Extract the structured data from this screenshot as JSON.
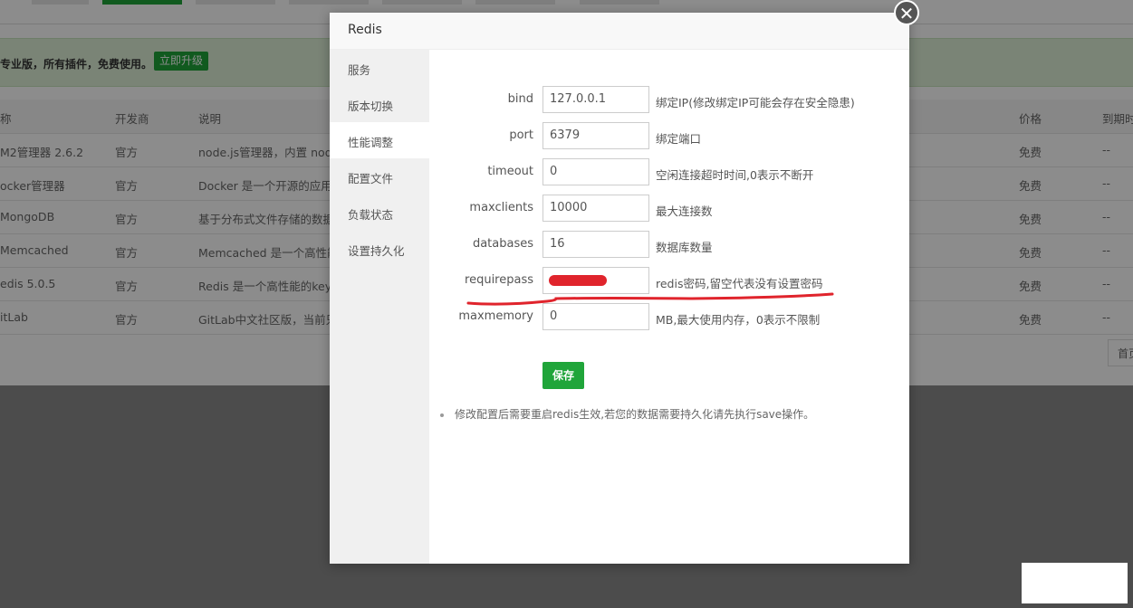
{
  "background": {
    "banner_text": "专业版，所有插件，免费使用。",
    "upgrade_label": "立即升级",
    "columns": {
      "name": "称",
      "developer": "开发商",
      "description": "说明",
      "price": "价格",
      "expire": "到期时"
    },
    "rows": [
      {
        "name": "M2管理器 2.6.2",
        "developer": "官方",
        "description": "node.js管理器，内置 node",
        "price": "免费",
        "expire": "--"
      },
      {
        "name": "ocker管理器",
        "developer": "官方",
        "description": "Docker 是一个开源的应用容",
        "price": "免费",
        "expire": "--"
      },
      {
        "name": "MongoDB",
        "developer": "官方",
        "description": "基于分布式文件存储的数据",
        "price": "免费",
        "expire": "--"
      },
      {
        "name": "Memcached",
        "developer": "官方",
        "description": "Memcached 是一个高性能",
        "price": "免费",
        "expire": "--"
      },
      {
        "name": "edis 5.0.5",
        "developer": "官方",
        "description": "Redis 是一个高性能的key-v",
        "price": "免费",
        "expire": "--"
      },
      {
        "name": "itLab",
        "developer": "官方",
        "description": "GitLab中文社区版，当前只",
        "price": "免费",
        "expire": "--"
      }
    ],
    "pager_label": "首页"
  },
  "modal": {
    "title": "Redis",
    "close_glyph": "✕",
    "sidebar": [
      {
        "label": "服务"
      },
      {
        "label": "版本切换"
      },
      {
        "label": "性能调整",
        "active": true
      },
      {
        "label": "配置文件"
      },
      {
        "label": "负载状态"
      },
      {
        "label": "设置持久化"
      }
    ],
    "fields": [
      {
        "label": "bind",
        "value": "127.0.0.1",
        "desc": "绑定IP(修改绑定IP可能会存在安全隐患)"
      },
      {
        "label": "port",
        "value": "6379",
        "desc": "绑定端口"
      },
      {
        "label": "timeout",
        "value": "0",
        "desc": "空闲连接超时时间,0表示不断开"
      },
      {
        "label": "maxclients",
        "value": "10000",
        "desc": "最大连接数"
      },
      {
        "label": "databases",
        "value": "16",
        "desc": "数据库数量"
      },
      {
        "label": "requirepass",
        "value": "",
        "desc": "redis密码,留空代表没有设置密码"
      },
      {
        "label": "maxmemory",
        "value": "0",
        "desc": "MB,最大使用内存，0表示不限制"
      }
    ],
    "save_label": "保存",
    "note": "修改配置后需要重启redis生效,若您的数据需要持久化请先执行save操作。"
  },
  "colors": {
    "accent": "#20a53a",
    "annotation": "#e0242c"
  }
}
